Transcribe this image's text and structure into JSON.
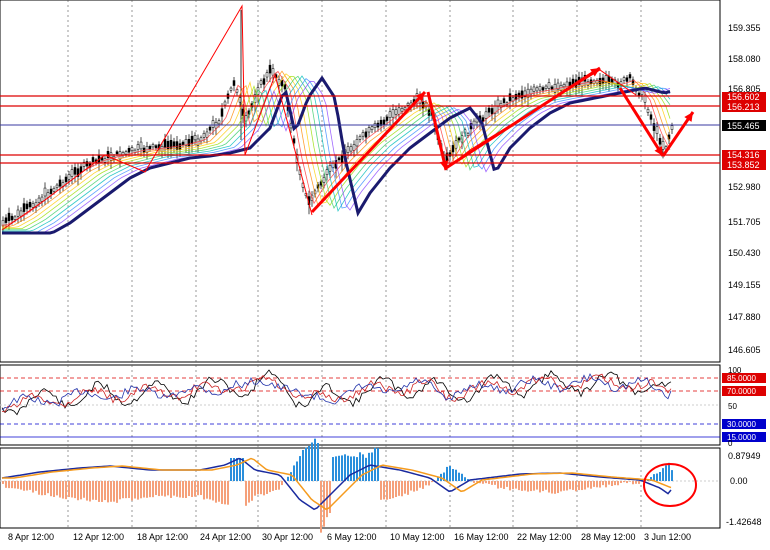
{
  "price_pane": {
    "y_labels": [
      "159.355",
      "158.080",
      "156.805",
      "155.465",
      "154.316",
      "153.852",
      "152.980",
      "151.705",
      "150.430",
      "149.155",
      "147.880",
      "146.605"
    ],
    "current_price": "155.465",
    "hlines": [
      {
        "label": "156.602",
        "color": "#dd0000"
      },
      {
        "label": "156.213",
        "color": "#dd0000"
      },
      {
        "label": "154.316",
        "color": "#dd0000"
      },
      {
        "label": "153.852",
        "color": "#dd0000"
      }
    ]
  },
  "rsi_pane": {
    "top_label": "100",
    "mid_label": "50",
    "bottom_label": "0",
    "levels": [
      {
        "label": "85.0000",
        "color": "#dd0000"
      },
      {
        "label": "70.0000",
        "color": "#dd0000"
      },
      {
        "label": "30.0000",
        "color": "#0000cc"
      },
      {
        "label": "15.0000",
        "color": "#0000cc"
      }
    ]
  },
  "macd_pane": {
    "top_label": "0.87949",
    "zero_label": "0.00",
    "bottom_label": "-1.42648"
  },
  "x_labels": [
    "8 Apr 12:00",
    "12 Apr 12:00",
    "18 Apr 12:00",
    "24 Apr 12:00",
    "30 Apr 12:00",
    "6 May 12:00",
    "10 May 12:00",
    "16 May 12:00",
    "22 May 12:00",
    "28 May 12:00",
    "3 Jun 12:00"
  ],
  "colors": {
    "background": "#ffffff",
    "candles": "#000000",
    "ma_main": "#1a1a6e",
    "annotation_red": "#ff0000",
    "macd_pos": "#2a8fdc",
    "macd_neg": "#f5a07a",
    "signal_orange": "#f59b1e"
  }
}
